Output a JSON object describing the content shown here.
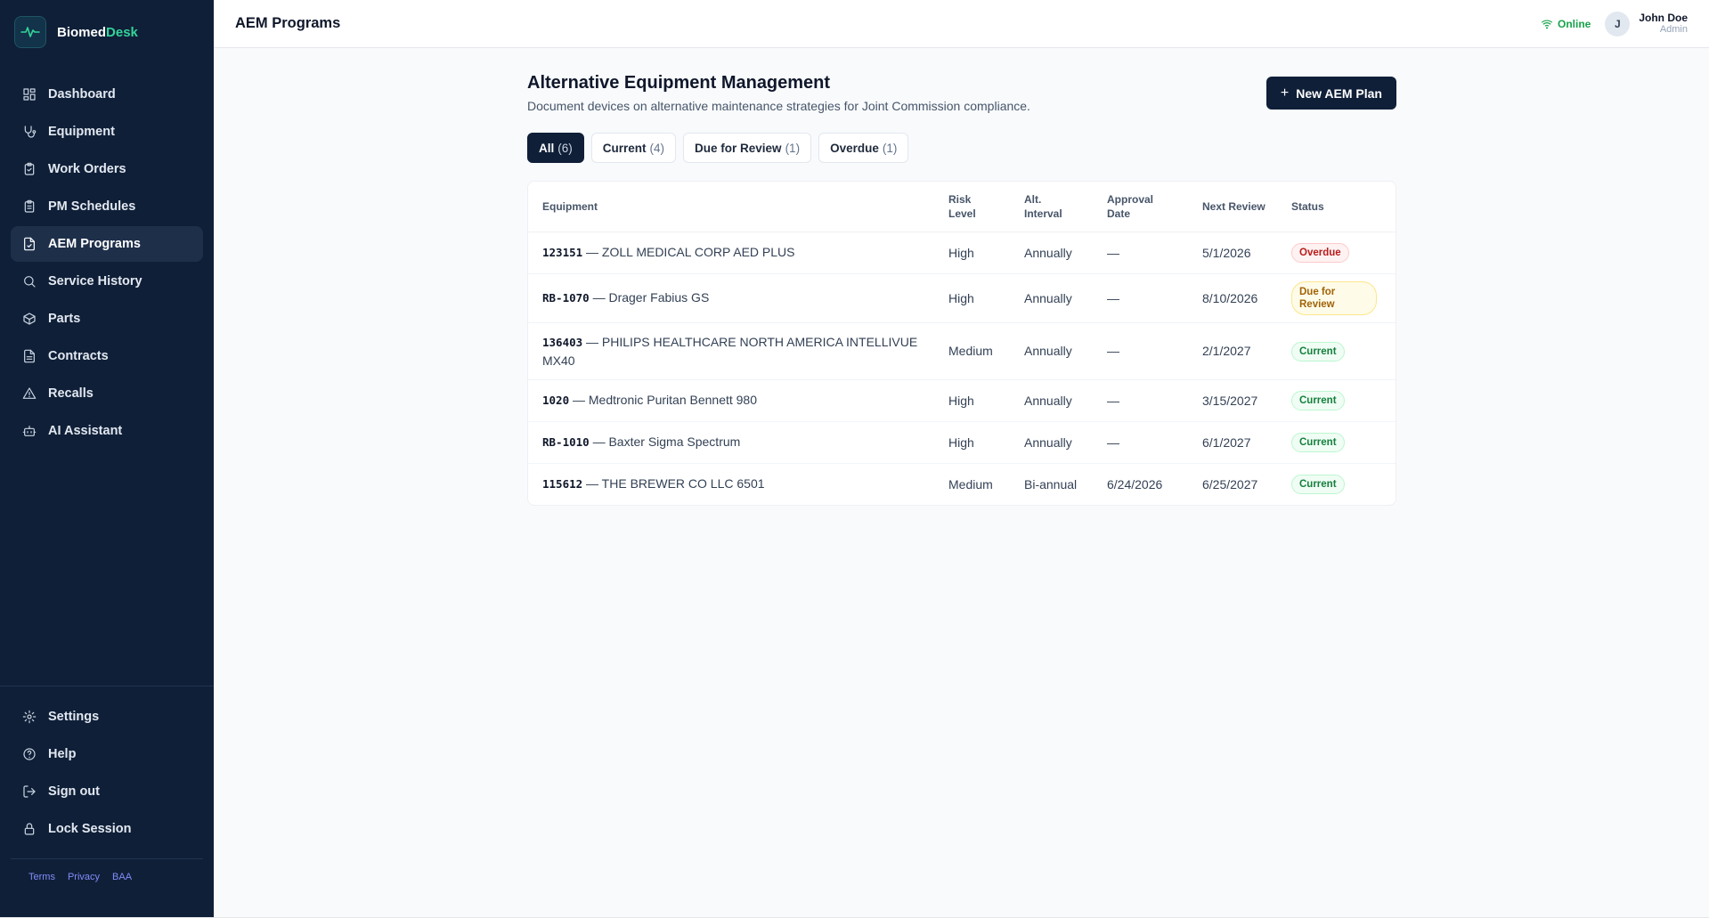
{
  "brand": {
    "name_part1": "Biomed",
    "name_part2": "Desk",
    "logo_icon": "heartbeat-icon"
  },
  "sidebar": {
    "items": [
      {
        "label": "Dashboard",
        "icon": "grid-icon"
      },
      {
        "label": "Equipment",
        "icon": "stethoscope-icon"
      },
      {
        "label": "Work Orders",
        "icon": "clipboard-check-icon"
      },
      {
        "label": "PM Schedules",
        "icon": "calendar-clipboard-icon"
      },
      {
        "label": "AEM Programs",
        "icon": "file-check-icon",
        "active": true
      },
      {
        "label": "Service History",
        "icon": "search-icon"
      },
      {
        "label": "Parts",
        "icon": "package-icon"
      },
      {
        "label": "Contracts",
        "icon": "document-icon"
      },
      {
        "label": "Recalls",
        "icon": "warning-icon"
      },
      {
        "label": "AI Assistant",
        "icon": "robot-icon"
      }
    ],
    "bottom_items": [
      {
        "label": "Settings",
        "icon": "gear-icon"
      },
      {
        "label": "Help",
        "icon": "help-icon"
      },
      {
        "label": "Sign out",
        "icon": "sign-out-icon"
      },
      {
        "label": "Lock Session",
        "icon": "lock-icon"
      }
    ],
    "legal": {
      "terms": "Terms",
      "privacy": "Privacy",
      "baa": "BAA"
    }
  },
  "header": {
    "title": "AEM Programs",
    "status": "Online",
    "avatar_initial": "J",
    "user_name": "John Doe",
    "user_role": "Admin"
  },
  "main": {
    "title": "Alternative Equipment Management",
    "subtitle": "Document devices on alternative maintenance strategies for Joint Commission compliance.",
    "new_button": "New AEM Plan",
    "tabs": [
      {
        "label": "All",
        "count": "(6)",
        "active": true
      },
      {
        "label": "Current",
        "count": "(4)"
      },
      {
        "label": "Due for Review",
        "count": "(1)"
      },
      {
        "label": "Overdue",
        "count": "(1)"
      }
    ],
    "table": {
      "headers": {
        "equipment": "Equipment",
        "risk_1": "Risk",
        "risk_2": "Level",
        "interval_1": "Alt.",
        "interval_2": "Interval",
        "approval_1": "Approval",
        "approval_2": "Date",
        "next_review": "Next Review",
        "status": "Status"
      },
      "rows": [
        {
          "tag": "123151",
          "name": " — ZOLL MEDICAL CORP AED PLUS",
          "risk": "High",
          "interval": "Annually",
          "approval": "—",
          "next_review": "5/1/2026",
          "status": "Overdue",
          "status_kind": "overdue"
        },
        {
          "tag": "RB-1070",
          "name": " — Drager Fabius GS",
          "risk": "High",
          "interval": "Annually",
          "approval": "—",
          "next_review": "8/10/2026",
          "status": "Due for Review",
          "status_kind": "review"
        },
        {
          "tag": "136403",
          "name": " — PHILIPS HEALTHCARE NORTH AMERICA INTELLIVUE MX40",
          "risk": "Medium",
          "interval": "Annually",
          "approval": "—",
          "next_review": "2/1/2027",
          "status": "Current",
          "status_kind": "current"
        },
        {
          "tag": "1020",
          "name": " — Medtronic Puritan Bennett 980",
          "risk": "High",
          "interval": "Annually",
          "approval": "—",
          "next_review": "3/15/2027",
          "status": "Current",
          "status_kind": "current"
        },
        {
          "tag": "RB-1010",
          "name": " — Baxter Sigma Spectrum",
          "risk": "High",
          "interval": "Annually",
          "approval": "—",
          "next_review": "6/1/2027",
          "status": "Current",
          "status_kind": "current"
        },
        {
          "tag": "115612",
          "name": " — THE BREWER CO LLC 6501",
          "risk": "Medium",
          "interval": "Bi-annual",
          "approval": "6/24/2026",
          "next_review": "6/25/2027",
          "status": "Current",
          "status_kind": "current"
        }
      ]
    }
  }
}
